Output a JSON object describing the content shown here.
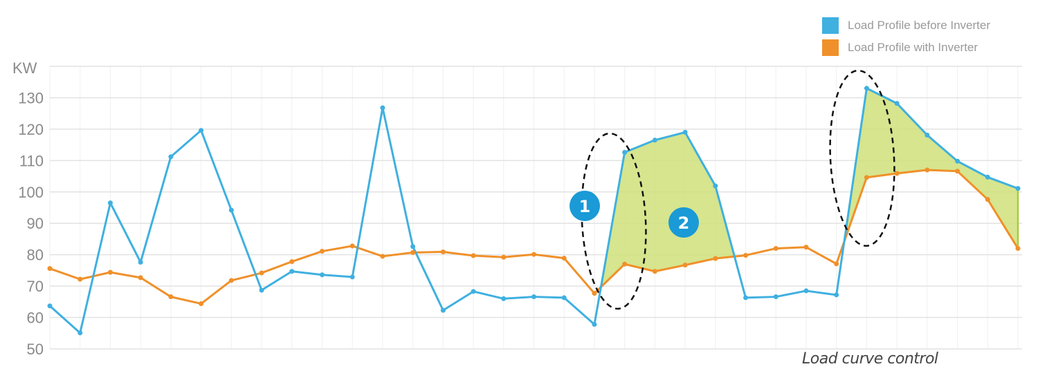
{
  "chart_data": {
    "type": "line",
    "title": "",
    "caption": "Load curve control",
    "xlabel": "",
    "ylabel": "KW",
    "ylim": [
      50,
      140
    ],
    "yticks": [
      50,
      60,
      70,
      80,
      90,
      100,
      110,
      120,
      130
    ],
    "grid": true,
    "legend_position": "top-right",
    "x": [
      1,
      2,
      3,
      4,
      5,
      6,
      7,
      8,
      9,
      10,
      11,
      12,
      13,
      14,
      15,
      16,
      17,
      18,
      19,
      20,
      21,
      22,
      23,
      24,
      25,
      26,
      27,
      28,
      29,
      30,
      31,
      32,
      33
    ],
    "series": [
      {
        "name": "Load Profile before Inverter",
        "color": "#3fb0e0",
        "values": [
          63.7,
          55.1,
          96.5,
          77.6,
          111.2,
          119.6,
          94.2,
          68.7,
          74.7,
          73.6,
          72.9,
          126.8,
          82.6,
          62.3,
          68.3,
          66.0,
          66.6,
          66.3,
          57.8,
          112.6,
          116.5,
          119.0,
          101.9,
          66.3,
          66.6,
          68.5,
          67.2,
          133.0,
          128.2,
          118.1,
          109.8,
          104.7,
          101.1
        ]
      },
      {
        "name": "Load Profile with Inverter",
        "color": "#f0902a",
        "values": [
          75.6,
          72.2,
          74.4,
          72.7,
          66.6,
          64.4,
          71.8,
          74.2,
          77.8,
          81.1,
          82.8,
          79.5,
          80.7,
          80.9,
          79.7,
          79.2,
          80.1,
          78.9,
          67.7,
          77.0,
          74.7,
          76.7,
          78.8,
          79.8,
          82.0,
          82.4,
          77.1,
          104.6,
          105.9,
          107.0,
          106.6,
          97.6,
          82.0
        ]
      }
    ],
    "shaded_regions": [
      {
        "from_index": 18,
        "to_index": 23,
        "fill": "#cfe07a",
        "label": "2"
      },
      {
        "from_index": 26,
        "to_index": 32,
        "fill": "#cfe07a"
      }
    ],
    "annotations": [
      {
        "type": "badge",
        "text": "1",
        "near_index": 18
      },
      {
        "type": "badge",
        "text": "2",
        "near_index": 21
      },
      {
        "type": "dashed-ellipse",
        "around_index": 19
      },
      {
        "type": "dashed-ellipse",
        "around_index": 27
      }
    ]
  },
  "legend": [
    {
      "label": "Load Profile before Inverter",
      "color": "#3fb0e0"
    },
    {
      "label": "Load Profile with Inverter",
      "color": "#f0902a"
    }
  ],
  "badge_color": "#1a9ad6"
}
